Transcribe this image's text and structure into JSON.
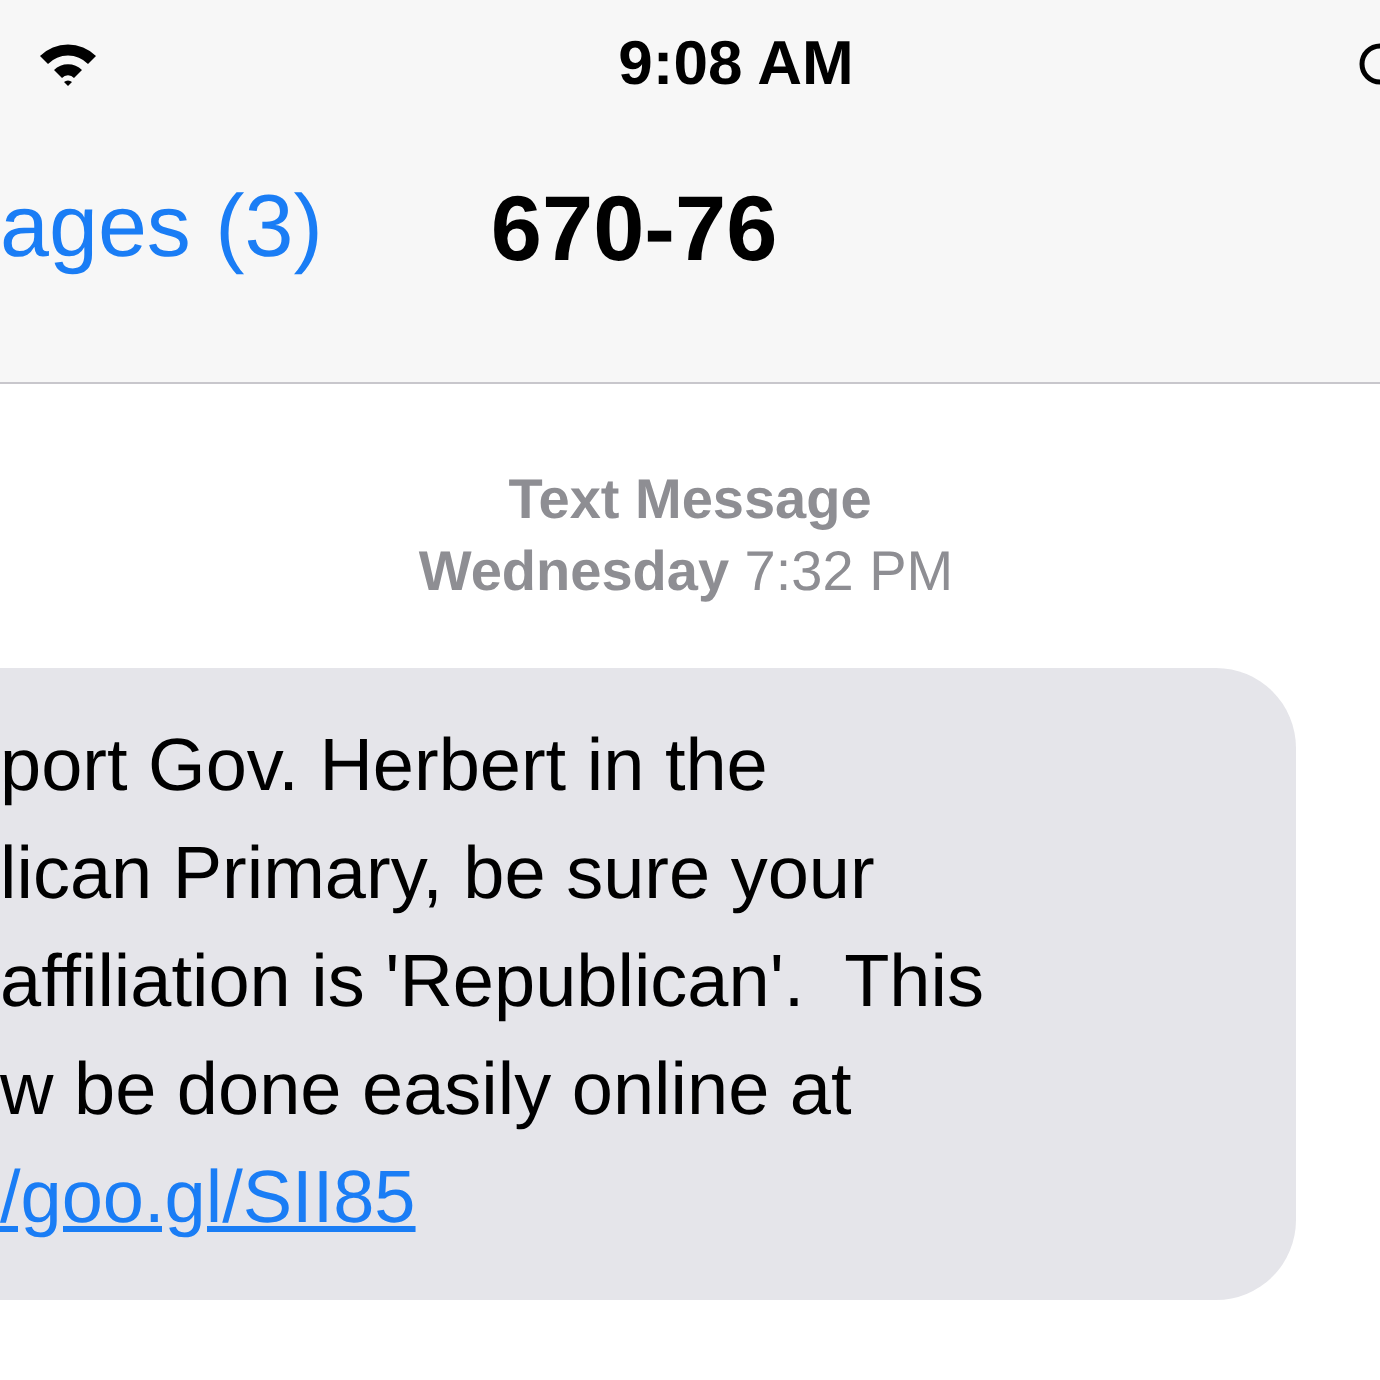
{
  "status_bar": {
    "time": "9:08 AM"
  },
  "nav_bar": {
    "back": "ages (3)",
    "title": "670-76"
  },
  "thread": {
    "service": "Text Message",
    "timestamp": "**Wednesday** 7:32 PM"
  },
  "message": {
    "lines": [
      "port Gov. Herbert in the",
      "lican Primary, be sure your",
      "affiliation is 'Republican'.  This",
      "w be done easily online at"
    ],
    "link": "/goo.gl/SII85"
  }
}
